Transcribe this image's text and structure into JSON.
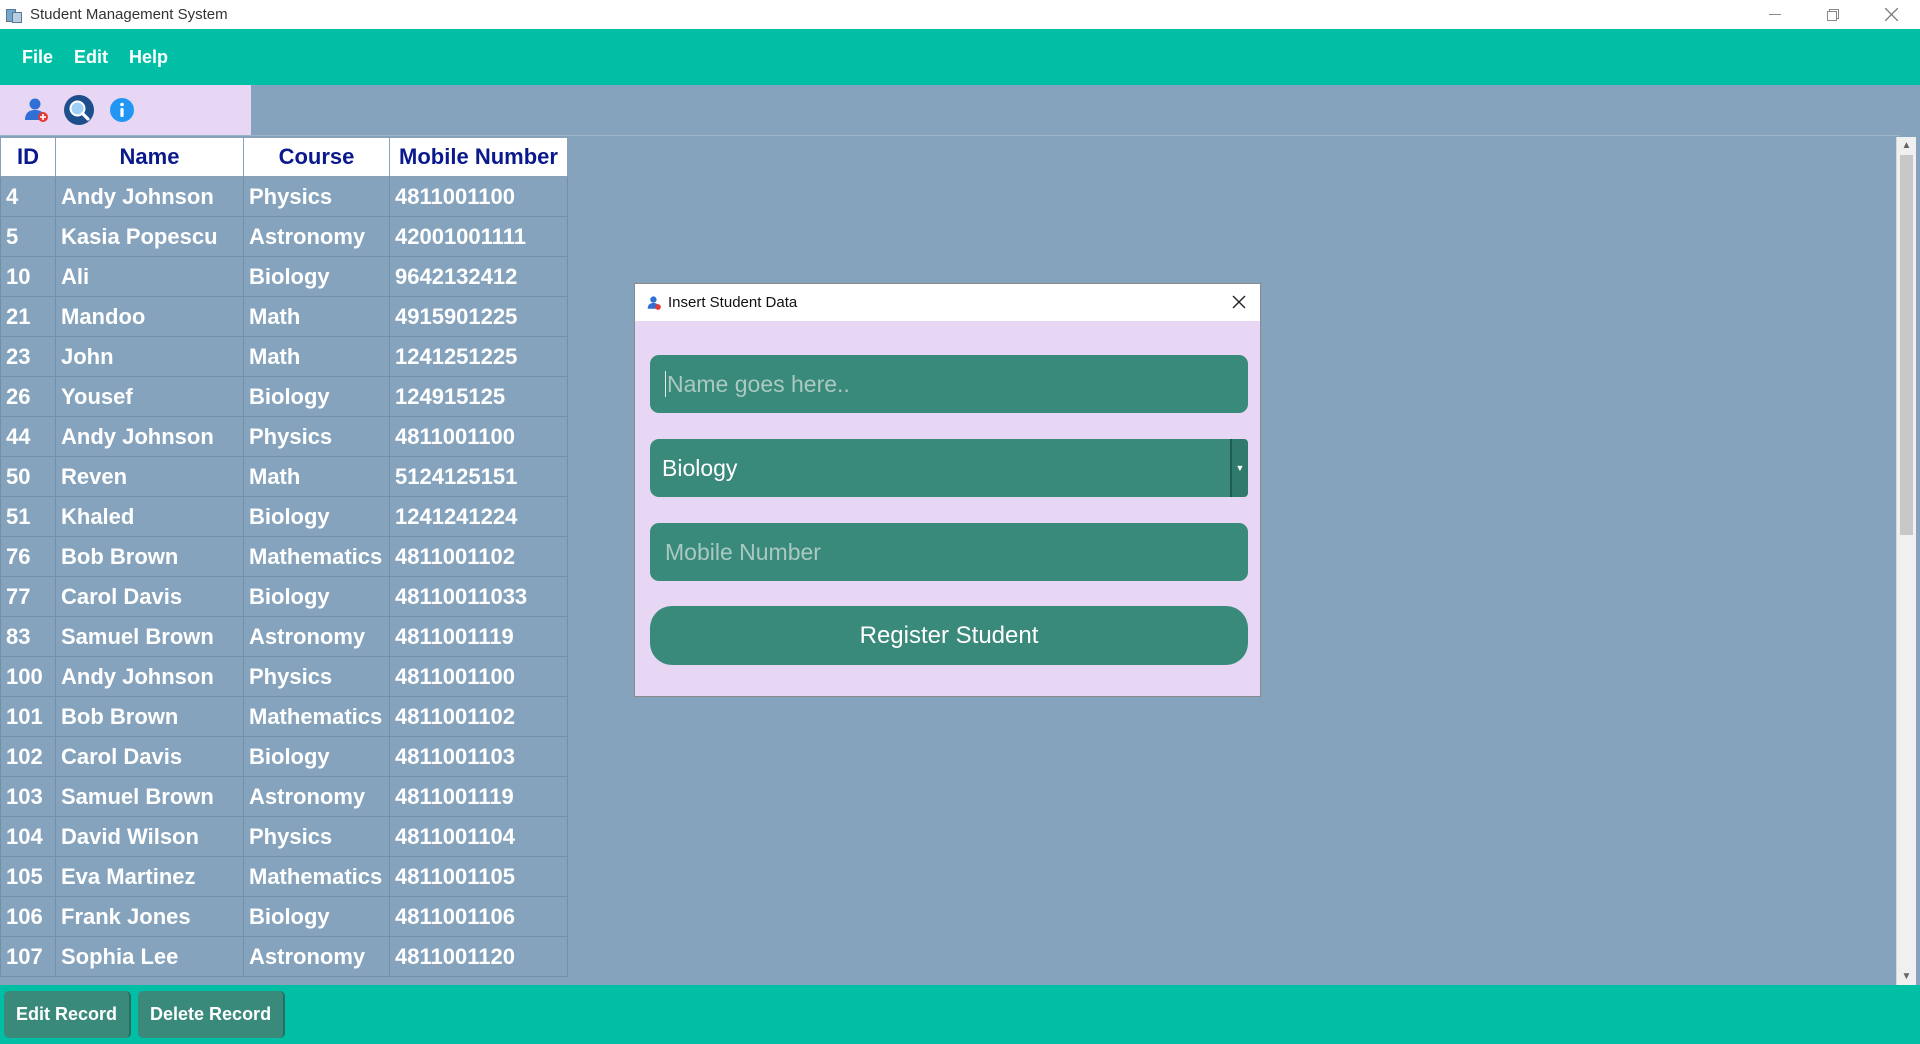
{
  "window": {
    "title": "Student Management System"
  },
  "menu": {
    "items": [
      "File",
      "Edit",
      "Help"
    ]
  },
  "toolbar": {
    "icons": [
      "add-student-icon",
      "search-icon",
      "info-icon"
    ]
  },
  "table": {
    "columns": [
      "ID",
      "Name",
      "Course",
      "Mobile Number"
    ],
    "rows": [
      [
        "4",
        "Andy Johnson",
        "Physics",
        "4811001100"
      ],
      [
        "5",
        "Kasia Popescu",
        "Astronomy",
        "42001001111"
      ],
      [
        "10",
        "Ali",
        "Biology",
        "9642132412"
      ],
      [
        "21",
        "Mandoo",
        "Math",
        "4915901225"
      ],
      [
        "23",
        "John",
        "Math",
        "1241251225"
      ],
      [
        "26",
        "Yousef",
        "Biology",
        "124915125"
      ],
      [
        "44",
        "Andy Johnson",
        "Physics",
        "4811001100"
      ],
      [
        "50",
        "Reven",
        "Math",
        "5124125151"
      ],
      [
        "51",
        "Khaled",
        "Biology",
        "1241241224"
      ],
      [
        "76",
        "Bob Brown",
        "Mathematics",
        "4811001102"
      ],
      [
        "77",
        "Carol Davis",
        "Biology",
        "48110011033"
      ],
      [
        "83",
        "Samuel Brown",
        "Astronomy",
        "4811001119"
      ],
      [
        "100",
        "Andy Johnson",
        "Physics",
        "4811001100"
      ],
      [
        "101",
        "Bob Brown",
        "Mathematics",
        "4811001102"
      ],
      [
        "102",
        "Carol Davis",
        "Biology",
        "4811001103"
      ],
      [
        "103",
        "Samuel Brown",
        "Astronomy",
        "4811001119"
      ],
      [
        "104",
        "David Wilson",
        "Physics",
        "4811001104"
      ],
      [
        "105",
        "Eva Martinez",
        "Mathematics",
        "4811001105"
      ],
      [
        "106",
        "Frank Jones",
        "Biology",
        "4811001106"
      ],
      [
        "107",
        "Sophia Lee",
        "Astronomy",
        "4811001120"
      ]
    ]
  },
  "bottom": {
    "edit_label": "Edit Record",
    "delete_label": "Delete Record"
  },
  "dialog": {
    "title": "Insert Student Data",
    "name_placeholder": "Name goes here..",
    "course_selected": "Biology",
    "mobile_placeholder": "Mobile Number",
    "register_label": "Register Student"
  },
  "colors": {
    "accent": "#00bfa5",
    "field": "#3a8a7c",
    "panel": "#e8d7f4",
    "background": "#85a3bd",
    "header_text": "#0a1a8c"
  }
}
